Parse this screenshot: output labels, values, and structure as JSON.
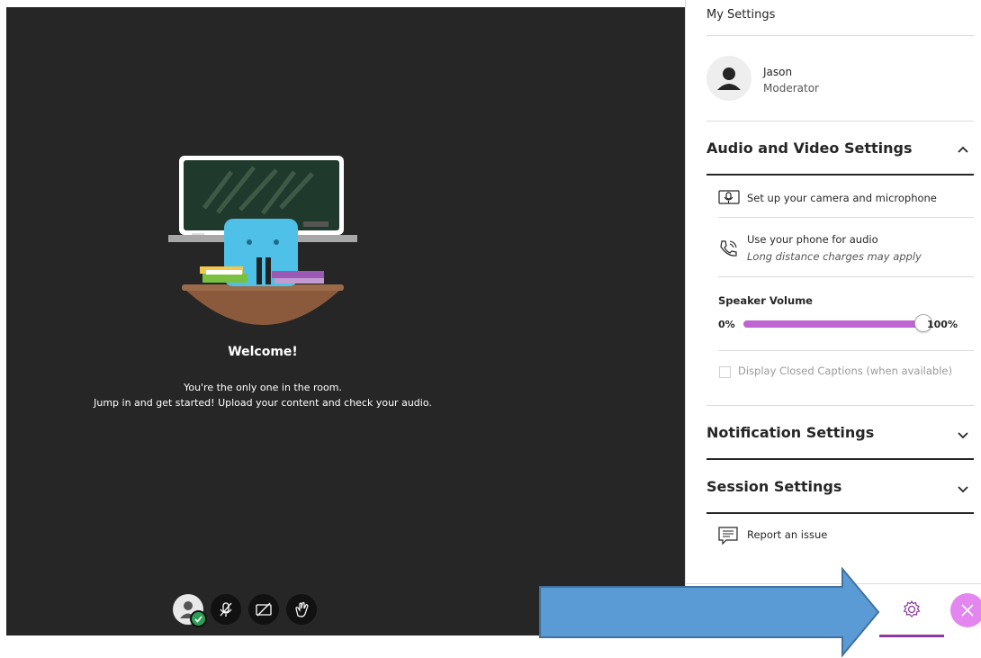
{
  "welcome": {
    "title": "Welcome!",
    "line1": "You're the only one in the room.",
    "line2": "Jump in and get started! Upload your content and check your audio."
  },
  "controls": [
    {
      "name": "my-status-button",
      "icon": "avatar-icon"
    },
    {
      "name": "microphone-button",
      "icon": "microphone-off-icon"
    },
    {
      "name": "camera-button",
      "icon": "camera-off-icon"
    },
    {
      "name": "raise-hand-button",
      "icon": "hand-icon"
    }
  ],
  "panel": {
    "title": "My Settings",
    "user": {
      "name": "Jason",
      "role": "Moderator"
    },
    "audio_video": {
      "title": "Audio and Video Settings",
      "camera_setup": "Set up your camera and microphone",
      "phone_audio": "Use your phone for audio",
      "phone_note": "Long distance charges may apply",
      "speaker_volume_label": "Speaker Volume",
      "volume_min": "0%",
      "volume_max": "100%",
      "volume_level": 1.0,
      "captions": "Display Closed Captions (when available)"
    },
    "notification_settings": "Notification Settings",
    "session_settings": "Session Settings",
    "report_issue": "Report an issue"
  },
  "colors": {
    "stage_bg": "#262626",
    "accent_purple": "#c064d1",
    "tab_underline": "#8c3a9e",
    "arrow_fill": "#5b9bd5",
    "arrow_stroke": "#41719c"
  }
}
